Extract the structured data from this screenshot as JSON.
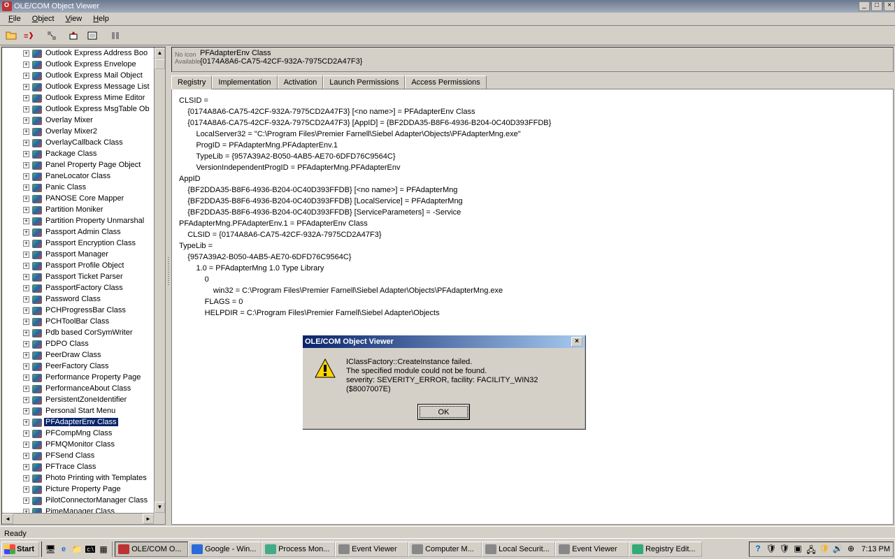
{
  "window": {
    "title": "OLE/COM Object Viewer"
  },
  "menus": [
    "File",
    "Object",
    "View",
    "Help"
  ],
  "tree_items": [
    {
      "label": "Outlook Express Address Boo",
      "sel": false
    },
    {
      "label": "Outlook Express Envelope",
      "sel": false
    },
    {
      "label": "Outlook Express Mail Object",
      "sel": false
    },
    {
      "label": "Outlook Express Message List",
      "sel": false
    },
    {
      "label": "Outlook Express Mime Editor",
      "sel": false
    },
    {
      "label": "Outlook Express MsgTable Ob",
      "sel": false
    },
    {
      "label": "Overlay Mixer",
      "sel": false
    },
    {
      "label": "Overlay Mixer2",
      "sel": false
    },
    {
      "label": "OverlayCallback Class",
      "sel": false
    },
    {
      "label": "Package Class",
      "sel": false
    },
    {
      "label": "Panel Property Page Object",
      "sel": false
    },
    {
      "label": "PaneLocator Class",
      "sel": false
    },
    {
      "label": "Panic Class",
      "sel": false
    },
    {
      "label": "PANOSE Core Mapper",
      "sel": false
    },
    {
      "label": "Partition Moniker",
      "sel": false
    },
    {
      "label": "Partition Property Unmarshal",
      "sel": false
    },
    {
      "label": "Passport Admin Class",
      "sel": false
    },
    {
      "label": "Passport Encryption Class",
      "sel": false
    },
    {
      "label": "Passport Manager",
      "sel": false
    },
    {
      "label": "Passport Profile Object",
      "sel": false
    },
    {
      "label": "Passport Ticket Parser",
      "sel": false
    },
    {
      "label": "PassportFactory Class",
      "sel": false
    },
    {
      "label": "Password Class",
      "sel": false
    },
    {
      "label": "PCHProgressBar Class",
      "sel": false
    },
    {
      "label": "PCHToolBar Class",
      "sel": false
    },
    {
      "label": "Pdb based CorSymWriter",
      "sel": false
    },
    {
      "label": "PDPO Class",
      "sel": false
    },
    {
      "label": "PeerDraw Class",
      "sel": false
    },
    {
      "label": "PeerFactory Class",
      "sel": false
    },
    {
      "label": "Performance Property Page",
      "sel": false
    },
    {
      "label": "PerformanceAbout Class",
      "sel": false
    },
    {
      "label": "PersistentZoneIdentifier",
      "sel": false
    },
    {
      "label": "Personal Start Menu",
      "sel": false
    },
    {
      "label": "PFAdapterEnv Class",
      "sel": true
    },
    {
      "label": "PFCompMng Class",
      "sel": false
    },
    {
      "label": "PFMQMonitor Class",
      "sel": false
    },
    {
      "label": "PFSend Class",
      "sel": false
    },
    {
      "label": "PFTrace Class",
      "sel": false
    },
    {
      "label": "Photo Printing with Templates",
      "sel": false
    },
    {
      "label": "Picture Property Page",
      "sel": false
    },
    {
      "label": "PilotConnectorManager Class",
      "sel": false
    },
    {
      "label": "PimeManager Class",
      "sel": false
    }
  ],
  "detail": {
    "noicon": "No icon Available",
    "title": "PFAdapterEnv Class",
    "guid": "{0174A8A6-CA75-42CF-932A-7975CD2A47F3}"
  },
  "tabs": [
    "Registry",
    "Implementation",
    "Activation",
    "Launch Permissions",
    "Access Permissions"
  ],
  "registry_lines": [
    "CLSID =",
    "    {0174A8A6-CA75-42CF-932A-7975CD2A47F3} [<no name>] = PFAdapterEnv Class",
    "    {0174A8A6-CA75-42CF-932A-7975CD2A47F3} [AppID] = {BF2DDA35-B8F6-4936-B204-0C40D393FFDB}",
    "        LocalServer32 = \"C:\\Program Files\\Premier Farnell\\Siebel Adapter\\Objects\\PFAdapterMng.exe\"",
    "        ProgID = PFAdapterMng.PFAdapterEnv.1",
    "        TypeLib = {957A39A2-B050-4AB5-AE70-6DFD76C9564C}",
    "        VersionIndependentProgID = PFAdapterMng.PFAdapterEnv",
    "AppID",
    "    {BF2DDA35-B8F6-4936-B204-0C40D393FFDB} [<no name>] = PFAdapterMng",
    "    {BF2DDA35-B8F6-4936-B204-0C40D393FFDB} [LocalService] = PFAdapterMng",
    "    {BF2DDA35-B8F6-4936-B204-0C40D393FFDB} [ServiceParameters] = -Service",
    "PFAdapterMng.PFAdapterEnv.1 = PFAdapterEnv Class",
    "    CLSID = {0174A8A6-CA75-42CF-932A-7975CD2A47F3}",
    "TypeLib =",
    "    {957A39A2-B050-4AB5-AE70-6DFD76C9564C}",
    "        1.0 = PFAdapterMng 1.0 Type Library",
    "            0",
    "                win32 = C:\\Program Files\\Premier Farnell\\Siebel Adapter\\Objects\\PFAdapterMng.exe",
    "            FLAGS = 0",
    "            HELPDIR = C:\\Program Files\\Premier Farnell\\Siebel Adapter\\Objects"
  ],
  "dialog": {
    "title": "OLE/COM Object Viewer",
    "line1": "IClassFactory::CreateInstance failed.",
    "line2": "The specified module could not be found.",
    "line3": "severity: SEVERITY_ERROR, facility: FACILITY_WIN32 ($8007007E)",
    "ok": "OK"
  },
  "status": "Ready",
  "taskbar": {
    "start": "Start",
    "tasks": [
      {
        "label": "OLE/COM O...",
        "active": true,
        "color": "#b33"
      },
      {
        "label": "Google - Win...",
        "active": false,
        "color": "#2a6bd8"
      },
      {
        "label": "Process Mon...",
        "active": false,
        "color": "#4a8"
      },
      {
        "label": "Event Viewer",
        "active": false,
        "color": "#888"
      },
      {
        "label": "Computer M...",
        "active": false,
        "color": "#888"
      },
      {
        "label": "Local Securit...",
        "active": false,
        "color": "#888"
      },
      {
        "label": "Event Viewer",
        "active": false,
        "color": "#888"
      },
      {
        "label": "Registry Edit...",
        "active": false,
        "color": "#3a7"
      }
    ],
    "time": "7:13 PM"
  }
}
